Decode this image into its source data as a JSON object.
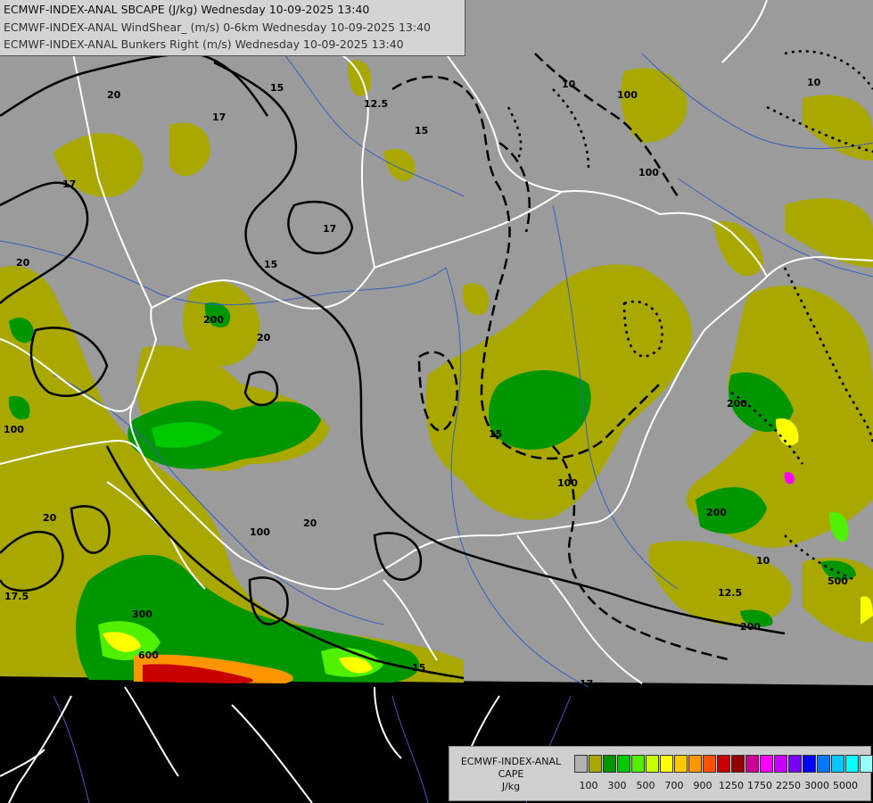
{
  "header": {
    "line1": "ECMWF-INDEX-ANAL SBCAPE (J/kg) Wednesday 10-09-2025 13:40",
    "line2": "ECMWF-INDEX-ANAL WindShear_ (m/s) 0-6km Wednesday 10-09-2025 13:40",
    "line3": "ECMWF-INDEX-ANAL Bunkers Right (m/s) Wednesday 10-09-2025 13:40"
  },
  "legend": {
    "title1": "ECMWF-INDEX-ANAL",
    "title2": "CAPE",
    "title3": "J/kg",
    "colors": [
      "#b2b2b2",
      "#a8a800",
      "#009600",
      "#00c800",
      "#50f000",
      "#c8ff00",
      "#ffff00",
      "#ffc800",
      "#ff9600",
      "#ff5000",
      "#c80000",
      "#960000",
      "#c80096",
      "#ff00ff",
      "#c800ff",
      "#7800ff",
      "#0000ff",
      "#0078ff",
      "#00c8ff",
      "#00ffff",
      "#96ffff",
      "#ffffff"
    ],
    "ticks": [
      "100",
      "300",
      "500",
      "700",
      "900",
      "1250",
      "1750",
      "2250",
      "3000",
      "5000"
    ]
  },
  "map": {
    "field": "SBCAPE",
    "colors": {
      "background": "#000000",
      "domain": "#9b9b9b",
      "cape_100": "#a8a800",
      "cape_300": "#009600",
      "cape_400": "#00c800",
      "cape_500": "#50f000",
      "cape_600": "#ffff00",
      "cape_800": "#ff9600",
      "cape_1000": "#c80000",
      "border": "#ffffff",
      "river": "#3a5fbf",
      "shear_contour": "#000000"
    },
    "contour_labels": [
      "20",
      "17",
      "15",
      "12.5",
      "10",
      "17.5",
      "100",
      "200",
      "300",
      "600",
      "500"
    ]
  }
}
